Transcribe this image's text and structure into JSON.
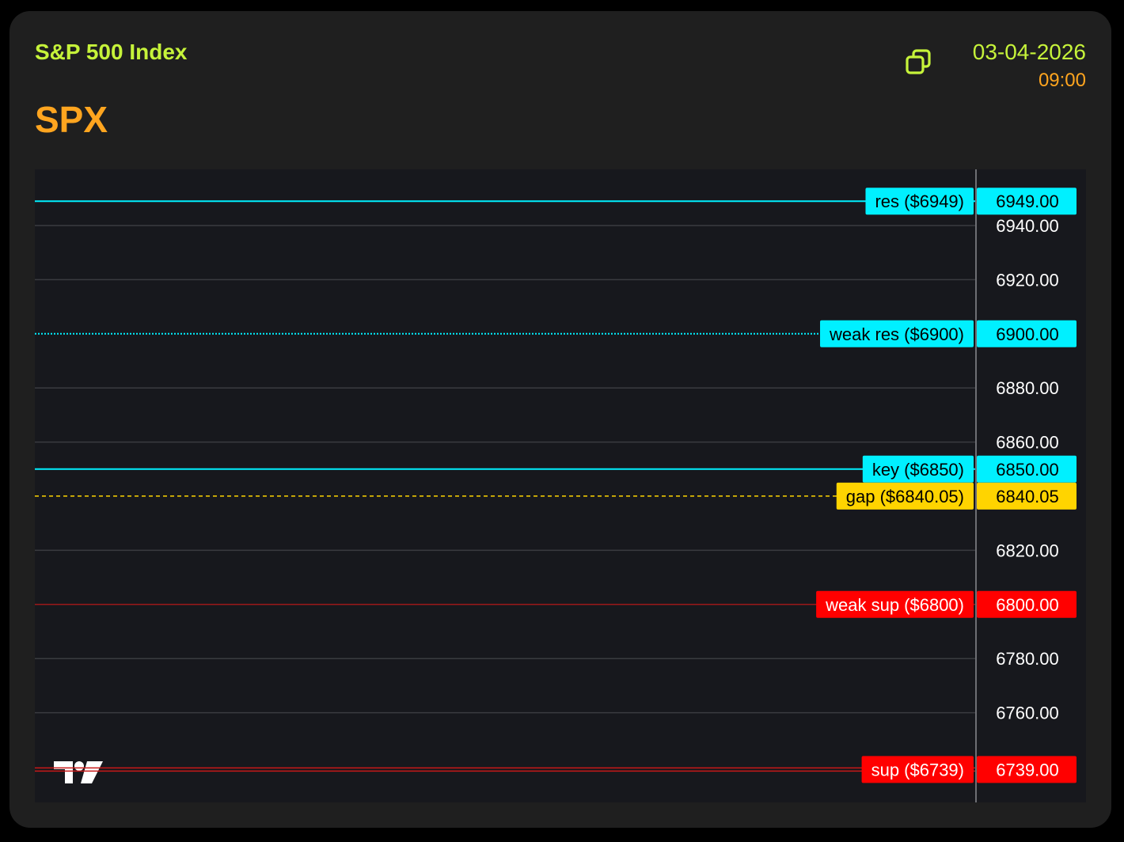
{
  "header": {
    "title": "S&P 500 Index",
    "symbol": "SPX",
    "date": "03-04-2026",
    "time": "09:00",
    "copy_icon": "copy-icon"
  },
  "colors": {
    "card_bg": "#1f1f1f",
    "chart_bg": "#17181d",
    "title": "#c6f33a",
    "symbol": "#ffa51f",
    "cyan": "#00f0ff",
    "yellow": "#ffd400",
    "red": "#ff0000",
    "grid": "#3a3b40",
    "axis_text": "#ffffff"
  },
  "chart_data": {
    "type": "price-levels",
    "y_range": [
      6730,
      6952
    ],
    "y_ticks": [
      "6940.00",
      "6920.00",
      "6880.00",
      "6860.00",
      "6820.00",
      "6780.00",
      "6760.00"
    ],
    "y_tick_values": [
      6940,
      6920,
      6880,
      6860,
      6820,
      6780,
      6760
    ],
    "levels": [
      {
        "label": "res ($6949)",
        "value": 6949,
        "axis_label": "6949.00",
        "color": "#00f0ff",
        "style": "solid"
      },
      {
        "label": "weak res ($6900)",
        "value": 6900,
        "axis_label": "6900.00",
        "color": "#00f0ff",
        "style": "dotted"
      },
      {
        "label": "key ($6850)",
        "value": 6850,
        "axis_label": "6850.00",
        "color": "#00f0ff",
        "style": "solid"
      },
      {
        "label": "gap ($6840.05)",
        "value": 6840.05,
        "axis_label": "6840.05",
        "color": "#ffd400",
        "style": "dashed"
      },
      {
        "label": "weak sup ($6800)",
        "value": 6800,
        "axis_label": "6800.00",
        "color": "#ff0000",
        "style": "thin"
      },
      {
        "label": "sup ($6739)",
        "value": 6739,
        "axis_label": "6739.00",
        "color": "#ff0000",
        "style": "double"
      }
    ],
    "grid": true
  }
}
